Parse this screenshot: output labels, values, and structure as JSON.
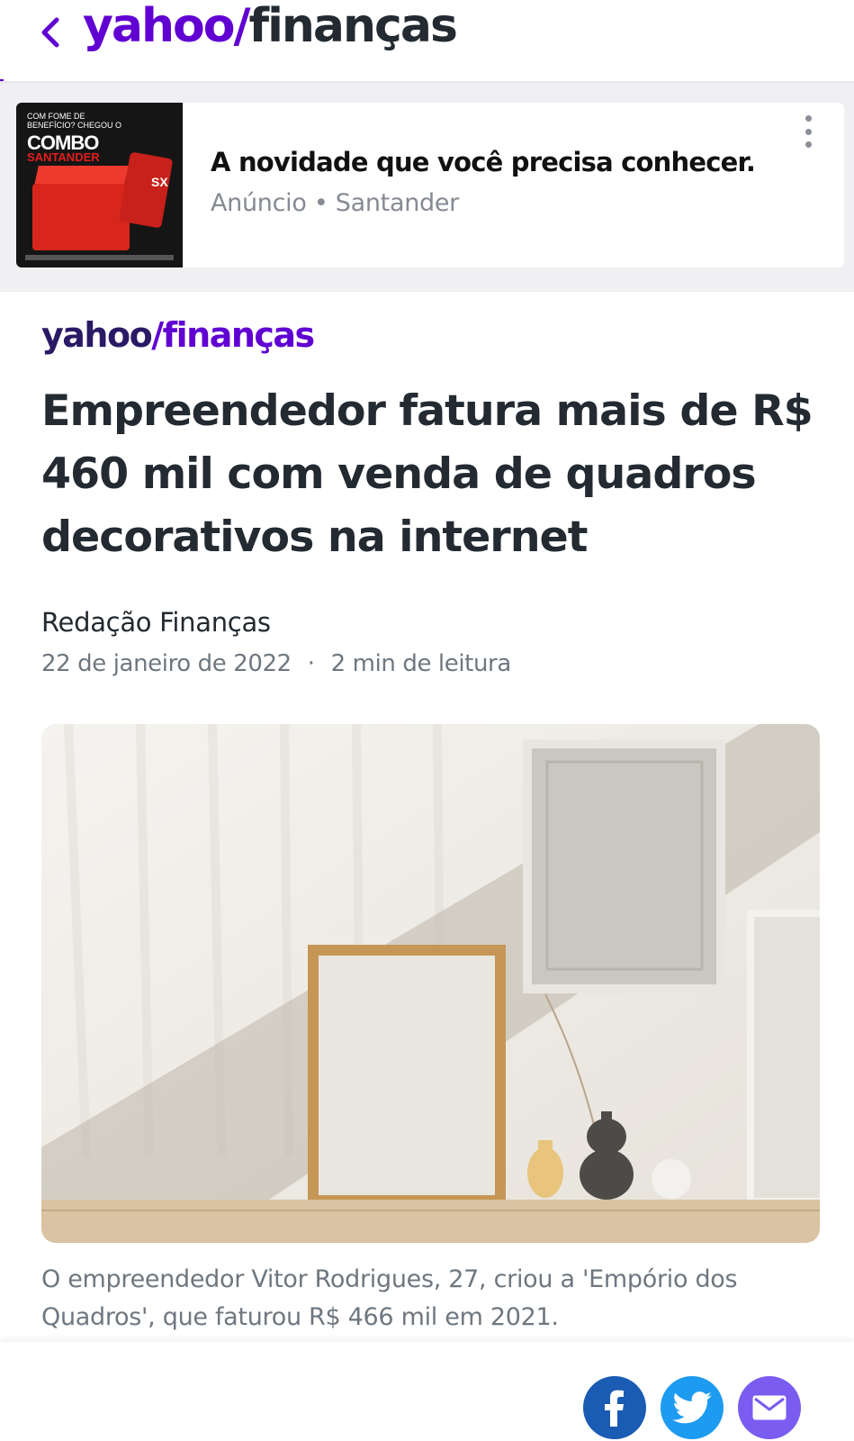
{
  "header": {
    "back_icon": "chevron-left-icon",
    "logo_yahoo": "yahoo",
    "logo_slash": "/",
    "logo_section": "finanças"
  },
  "ad": {
    "image_headline_small": "COM FOME DE BENEFÍCIO? CHEGOU O",
    "image_brand": "COMBO",
    "image_sub": "SANTANDER",
    "image_card_text": "SX",
    "title": "A novidade que você precisa conhecer.",
    "meta": "Anúncio • Santander",
    "more_icon": "kebab-menu-icon"
  },
  "article": {
    "brand_yahoo": "yahoo",
    "brand_slash": "/",
    "brand_section": "finanças",
    "title": "Empreendedor fatura mais de R$ 460 mil com venda de quadros decorativos na internet",
    "author": "Redação Finanças",
    "date": "22 de janeiro de 2022",
    "separator": "·",
    "read_time": "2 min de leitura",
    "caption": "O empreendedor Vitor Rodrigues, 27, criou a 'Empório dos Quadros', que faturou R$ 466 mil em 2021."
  },
  "share": {
    "facebook_icon": "facebook-icon",
    "twitter_icon": "twitter-icon",
    "email_icon": "mail-icon",
    "colors": {
      "facebook": "#1a5bb3",
      "twitter": "#1d9bf0",
      "email": "#7b5cf0"
    }
  },
  "colors": {
    "brand_purple": "#6001d2",
    "text_dark": "#232a31",
    "text_muted": "#6e7780"
  }
}
